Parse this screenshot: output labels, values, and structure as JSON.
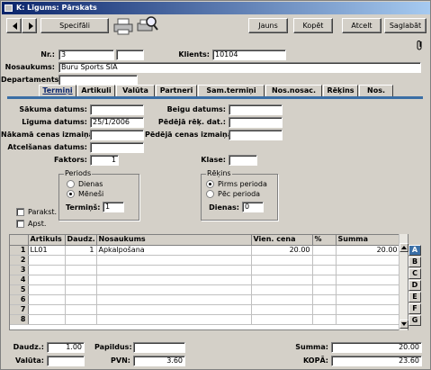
{
  "window": {
    "title": "K: Līgums: Pārskats"
  },
  "toolbar": {
    "special_label": "Specifāli",
    "new_label": "Jauns",
    "copy_label": "Kopēt",
    "cancel_label": "Atcelt",
    "save_label": "Saglabāt"
  },
  "header": {
    "nr_label": "Nr.:",
    "nr_value": "3",
    "nr_extra1": "",
    "nr_extra2": "",
    "client_label": "Klients:",
    "client_value": "10104",
    "name_label": "Nosaukums:",
    "name_value": "Buru Sports SIA",
    "dept_label": "Departaments:",
    "dept_value": ""
  },
  "tabs": [
    "Termiņi",
    "Artikuli",
    "Valūta",
    "Partneri",
    "Sam.termiņi",
    "Nos.nosac.",
    "Rēķins",
    "Nos."
  ],
  "terms": {
    "start_label": "Sākuma datums:",
    "start_value": "",
    "contract_label": "Līguma datums:",
    "contract_value": "25/1/2006",
    "next_price_label": "Nākamā cenas izmaiņa:",
    "next_price_value": "",
    "cancel_date_label": "Atcelšanas datums:",
    "cancel_date_value": "",
    "factor_label": "Faktors:",
    "factor_value": "1",
    "end_label": "Beigu datums:",
    "end_value": "",
    "last_inv_label": "Pēdējā rēķ. dat.:",
    "last_inv_value": "",
    "last_price_label": "Pēdējā cenas izmaiņa:",
    "last_price_value": "",
    "class_label": "Klase:",
    "class_value": ""
  },
  "period_group": {
    "title": "Periods",
    "opt_days": "Dienas",
    "opt_months": "Mēneši",
    "term_label": "Termiņš:",
    "term_value": "1"
  },
  "invoice_group": {
    "title": "Rēķins",
    "opt_before": "Pirms perioda",
    "opt_after": "Pēc perioda",
    "days_label": "Dienas:",
    "days_value": "0"
  },
  "checks": {
    "signed": "Parakst.",
    "approved": "Apst."
  },
  "grid": {
    "headers": [
      "Artikuls",
      "Daudz.",
      "Nosaukums",
      "Vien. cena",
      "%",
      "Summa"
    ],
    "rows": [
      {
        "n": "1",
        "art": "LL01",
        "qty": "1",
        "name": "Apkalpošana",
        "price": "20.00",
        "pct": "",
        "sum": "20.00"
      },
      {
        "n": "2",
        "art": "",
        "qty": "",
        "name": "",
        "price": "",
        "pct": "",
        "sum": ""
      },
      {
        "n": "3",
        "art": "",
        "qty": "",
        "name": "",
        "price": "",
        "pct": "",
        "sum": ""
      },
      {
        "n": "4",
        "art": "",
        "qty": "",
        "name": "",
        "price": "",
        "pct": "",
        "sum": ""
      },
      {
        "n": "5",
        "art": "",
        "qty": "",
        "name": "",
        "price": "",
        "pct": "",
        "sum": ""
      },
      {
        "n": "6",
        "art": "",
        "qty": "",
        "name": "",
        "price": "",
        "pct": "",
        "sum": ""
      },
      {
        "n": "7",
        "art": "",
        "qty": "",
        "name": "",
        "price": "",
        "pct": "",
        "sum": ""
      },
      {
        "n": "8",
        "art": "",
        "qty": "",
        "name": "",
        "price": "",
        "pct": "",
        "sum": ""
      }
    ],
    "side_buttons": [
      "A",
      "B",
      "C",
      "D",
      "E",
      "F",
      "G"
    ]
  },
  "footer": {
    "qty_label": "Daudz.:",
    "qty_value": "1.00",
    "currency_label": "Valūta:",
    "currency_value": "",
    "extra_label": "Papildus:",
    "extra_value": "",
    "vat_label": "PVN:",
    "vat_value": "3.60",
    "sum_label": "Summa:",
    "sum_value": "20.00",
    "total_label": "KOPĀ:",
    "total_value": "23.60"
  }
}
